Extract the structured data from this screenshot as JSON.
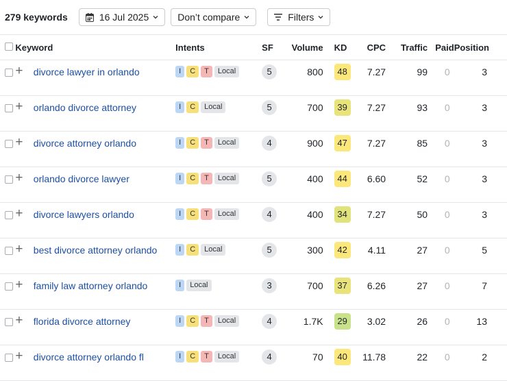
{
  "toolbar": {
    "keyword_count": "279 keywords",
    "date": "16 Jul 2025",
    "compare": "Don’t compare",
    "filters": "Filters"
  },
  "columns": {
    "keyword": "Keyword",
    "intents": "Intents",
    "sf": "SF",
    "volume": "Volume",
    "kd": "KD",
    "cpc": "CPC",
    "traffic": "Traffic",
    "paid": "Paid",
    "position": "Position"
  },
  "kd_colors": {
    "yellow": "#fce77a",
    "olive": "#d6e27c",
    "green": "#bfe28f"
  },
  "rows": [
    {
      "keyword": "divorce lawyer in orlando",
      "intents": [
        "I",
        "C",
        "T"
      ],
      "local": "Local",
      "sf": "5",
      "volume": "800",
      "kd": "48",
      "kd_color": "#fce77a",
      "cpc": "7.27",
      "traffic": "99",
      "paid": "0",
      "position": "3"
    },
    {
      "keyword": "orlando divorce attorney",
      "intents": [
        "I",
        "C"
      ],
      "local": "Local",
      "sf": "5",
      "volume": "700",
      "kd": "39",
      "kd_color": "#e8e37a",
      "cpc": "7.27",
      "traffic": "93",
      "paid": "0",
      "position": "3"
    },
    {
      "keyword": "divorce attorney orlando",
      "intents": [
        "I",
        "C",
        "T"
      ],
      "local": "Local",
      "sf": "4",
      "volume": "900",
      "kd": "47",
      "kd_color": "#fce77a",
      "cpc": "7.27",
      "traffic": "85",
      "paid": "0",
      "position": "3"
    },
    {
      "keyword": "orlando divorce lawyer",
      "intents": [
        "I",
        "C",
        "T"
      ],
      "local": "Local",
      "sf": "5",
      "volume": "400",
      "kd": "44",
      "kd_color": "#fce77a",
      "cpc": "6.60",
      "traffic": "52",
      "paid": "0",
      "position": "3"
    },
    {
      "keyword": "divorce lawyers orlando",
      "intents": [
        "I",
        "C",
        "T"
      ],
      "local": "Local",
      "sf": "4",
      "volume": "400",
      "kd": "34",
      "kd_color": "#e0e27c",
      "cpc": "7.27",
      "traffic": "50",
      "paid": "0",
      "position": "3"
    },
    {
      "keyword": "best divorce attorney orlando",
      "intents": [
        "I",
        "C"
      ],
      "local": "Local",
      "sf": "5",
      "volume": "300",
      "kd": "42",
      "kd_color": "#fce77a",
      "cpc": "4.11",
      "traffic": "27",
      "paid": "0",
      "position": "5"
    },
    {
      "keyword": "family law attorney orlando",
      "intents": [
        "I"
      ],
      "local": "Local",
      "sf": "3",
      "volume": "700",
      "kd": "37",
      "kd_color": "#e8e37a",
      "cpc": "6.26",
      "traffic": "27",
      "paid": "0",
      "position": "7"
    },
    {
      "keyword": "florida divorce attorney",
      "intents": [
        "I",
        "C",
        "T"
      ],
      "local": "Local",
      "sf": "4",
      "volume": "1.7K",
      "kd": "29",
      "kd_color": "#c8e28c",
      "cpc": "3.02",
      "traffic": "26",
      "paid": "0",
      "position": "13"
    },
    {
      "keyword": "divorce attorney orlando fl",
      "intents": [
        "I",
        "C",
        "T"
      ],
      "local": "Local",
      "sf": "4",
      "volume": "70",
      "kd": "40",
      "kd_color": "#fce77a",
      "cpc": "11.78",
      "traffic": "22",
      "paid": "0",
      "position": "2"
    }
  ]
}
